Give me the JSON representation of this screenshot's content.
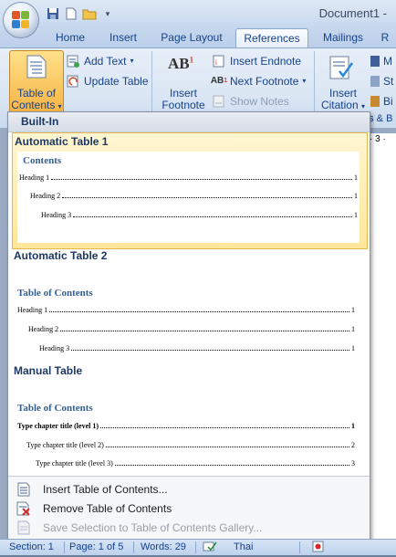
{
  "window": {
    "title": "Document1 -"
  },
  "tabs": [
    {
      "label": "Home"
    },
    {
      "label": "Insert"
    },
    {
      "label": "Page Layout"
    },
    {
      "label": "References"
    },
    {
      "label": "Mailings"
    },
    {
      "label": "R"
    }
  ],
  "ribbon": {
    "toc_button": {
      "line1": "Table of",
      "line2": "Contents"
    },
    "add_text": "Add Text",
    "update_table": "Update Table",
    "insert_footnote": {
      "line1": "Insert",
      "line2": "Footnote"
    },
    "insert_endnote": "Insert Endnote",
    "next_footnote": "Next Footnote",
    "show_notes": "Show Notes",
    "insert_citation": {
      "line1": "Insert",
      "line2": "Citation"
    },
    "cut_off_labels": [
      "M",
      "St",
      "Bi"
    ],
    "group_label_partial": "ns & B",
    "ruler_text": "· 3 ·"
  },
  "gallery": {
    "section_header": "Built-In",
    "entries": [
      {
        "title": "Automatic Table 1",
        "preview_title": "Contents",
        "lines": [
          {
            "text": "Heading 1",
            "page": "1"
          },
          {
            "text": "Heading 2",
            "page": "1"
          },
          {
            "text": "Heading 3",
            "page": "1"
          }
        ]
      },
      {
        "title": "Automatic Table 2",
        "preview_title": "Table of Contents",
        "lines": [
          {
            "text": "Heading 1",
            "page": "1"
          },
          {
            "text": "Heading 2",
            "page": "1"
          },
          {
            "text": "Heading 3",
            "page": "1"
          }
        ]
      },
      {
        "title": "Manual Table",
        "preview_title": "Table of Contents",
        "lines": [
          {
            "text": "Type chapter title (level 1)",
            "page": "1"
          },
          {
            "text": "Type chapter title (level 2)",
            "page": "2"
          },
          {
            "text": "Type chapter title (level 3)",
            "page": "3"
          }
        ]
      }
    ],
    "commands": [
      {
        "label": "Insert Table of Contents...",
        "icon": "insert-toc-icon",
        "enabled": true
      },
      {
        "label": "Remove Table of Contents",
        "icon": "remove-toc-icon",
        "enabled": true
      },
      {
        "label": "Save Selection to Table of Contents Gallery...",
        "icon": "save-selection-icon",
        "enabled": false
      }
    ]
  },
  "statusbar": {
    "section": "Section: 1",
    "page": "Page: 1 of 5",
    "words": "Words: 29",
    "language": "Thai"
  },
  "colors": {
    "ribbon_text": "#15428b",
    "highlight": "#ffe69a",
    "preview_title": "#365f91"
  }
}
